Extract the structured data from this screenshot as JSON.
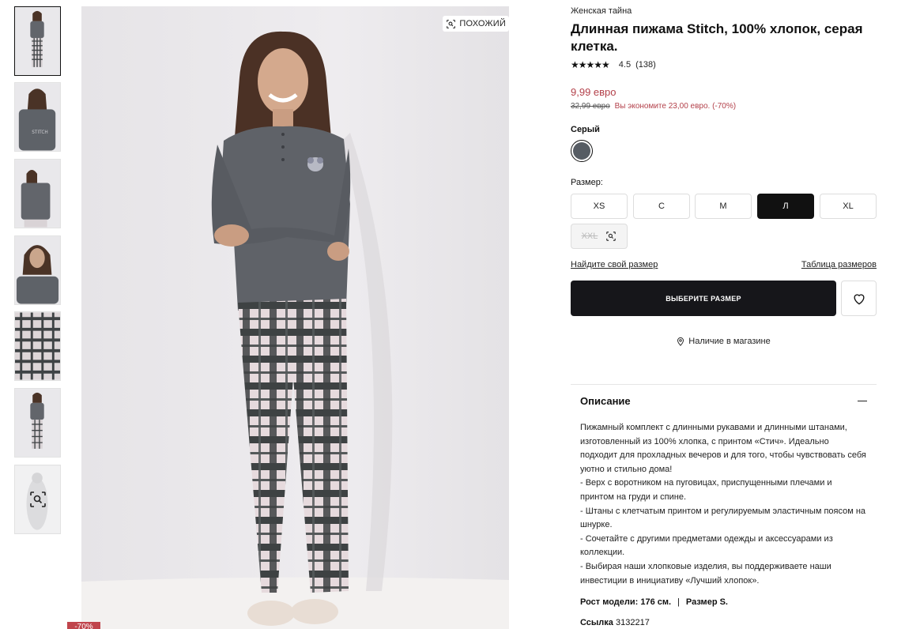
{
  "gallery": {
    "similar_label": "ПОХОЖИЙ",
    "discount_badge": "-70%",
    "thumbnails": [
      {
        "name": "front-full"
      },
      {
        "name": "back"
      },
      {
        "name": "front-crop"
      },
      {
        "name": "close-up"
      },
      {
        "name": "pants-detail"
      },
      {
        "name": "front-full-2"
      },
      {
        "name": "similar-search"
      }
    ]
  },
  "product": {
    "brand": "Женская тайна",
    "title": "Длинная пижама Stitch, 100% хлопок, серая клетка.",
    "rating_stars": "★★★★★",
    "rating": "4.5",
    "review_count": "(138)",
    "price": "9,99 евро",
    "old_price": "32,99 евро",
    "savings": "Вы экономите  23,00 евро. (-70%)",
    "color_label": "Серый",
    "color_hex": "#565c63",
    "size_label": "Размер:",
    "sizes": [
      {
        "label": "XS",
        "state": "available"
      },
      {
        "label": "C",
        "state": "available"
      },
      {
        "label": "M",
        "state": "available"
      },
      {
        "label": "Л",
        "state": "selected"
      },
      {
        "label": "XL",
        "state": "available"
      },
      {
        "label": "XXL",
        "state": "unavailable"
      }
    ],
    "find_size_link": "Найдите свой размер",
    "size_chart_link": "Таблица размеров",
    "cta_label": "ВЫБЕРИТЕ РАЗМЕР",
    "store_availability": "Наличие в магазине"
  },
  "description": {
    "title": "Описание",
    "lines": [
      "Пижамный комплект с длинными рукавами и длинными штанами, изготовленный из 100% хлопка, с принтом «Стич». Идеально подходит для прохладных вечеров и для того, чтобы чувствовать себя уютно и стильно дома!",
      "- Верх с воротником на пуговицах, приспущенными плечами и принтом на груди и спине.",
      "- Штаны с клетчатым принтом и регулируемым эластичным поясом на шнурке.",
      "- Сочетайте с другими предметами одежды и аксессуарами из коллекции.",
      "- Выбирая наши хлопковые изделия, вы поддерживаете наши инвестиции в инициативу «Лучший хлопок»."
    ],
    "model_height": "Рост модели: 176 см.",
    "model_size": "Размер S.",
    "ref_label": "Ссылка",
    "ref_value": "3132217"
  },
  "colors": {
    "accent_price": "#b3404a",
    "cta_bg": "#16161a",
    "badge": "#c0454c"
  }
}
